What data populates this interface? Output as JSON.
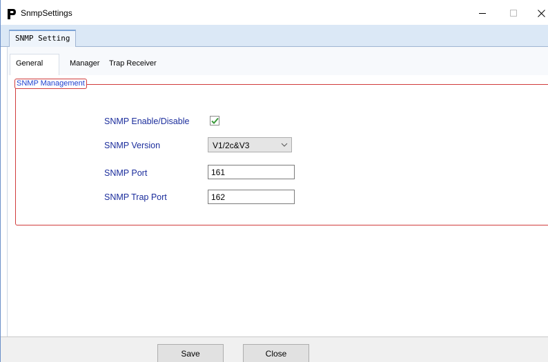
{
  "window": {
    "title": "SnmpSettings",
    "icon": "p-logo-icon",
    "controls": [
      "minimize-icon",
      "maximize-icon",
      "close-icon"
    ]
  },
  "outer_tabs": [
    {
      "label": "SNMP Setting",
      "active": true
    }
  ],
  "inner_tabs": [
    {
      "label": "General",
      "active": true
    },
    {
      "label": "Manager",
      "active": false
    },
    {
      "label": "Trap Receiver",
      "active": false
    }
  ],
  "group": {
    "title": "SNMP Management",
    "border_color": "#d03a3a"
  },
  "fields": {
    "enable": {
      "label": "SNMP Enable/Disable",
      "checked": true
    },
    "version": {
      "label": "SNMP Version",
      "value": "V1/2c&V3"
    },
    "port": {
      "label": "SNMP Port",
      "value": "161"
    },
    "trap_port": {
      "label": "SNMP Trap Port",
      "value": "162"
    }
  },
  "buttons": {
    "save": "Save",
    "close": "Close"
  },
  "colors": {
    "label_text": "#1b2d9c",
    "group_title_text": "#1d3fcf",
    "check_mark": "#3a9a3a"
  }
}
